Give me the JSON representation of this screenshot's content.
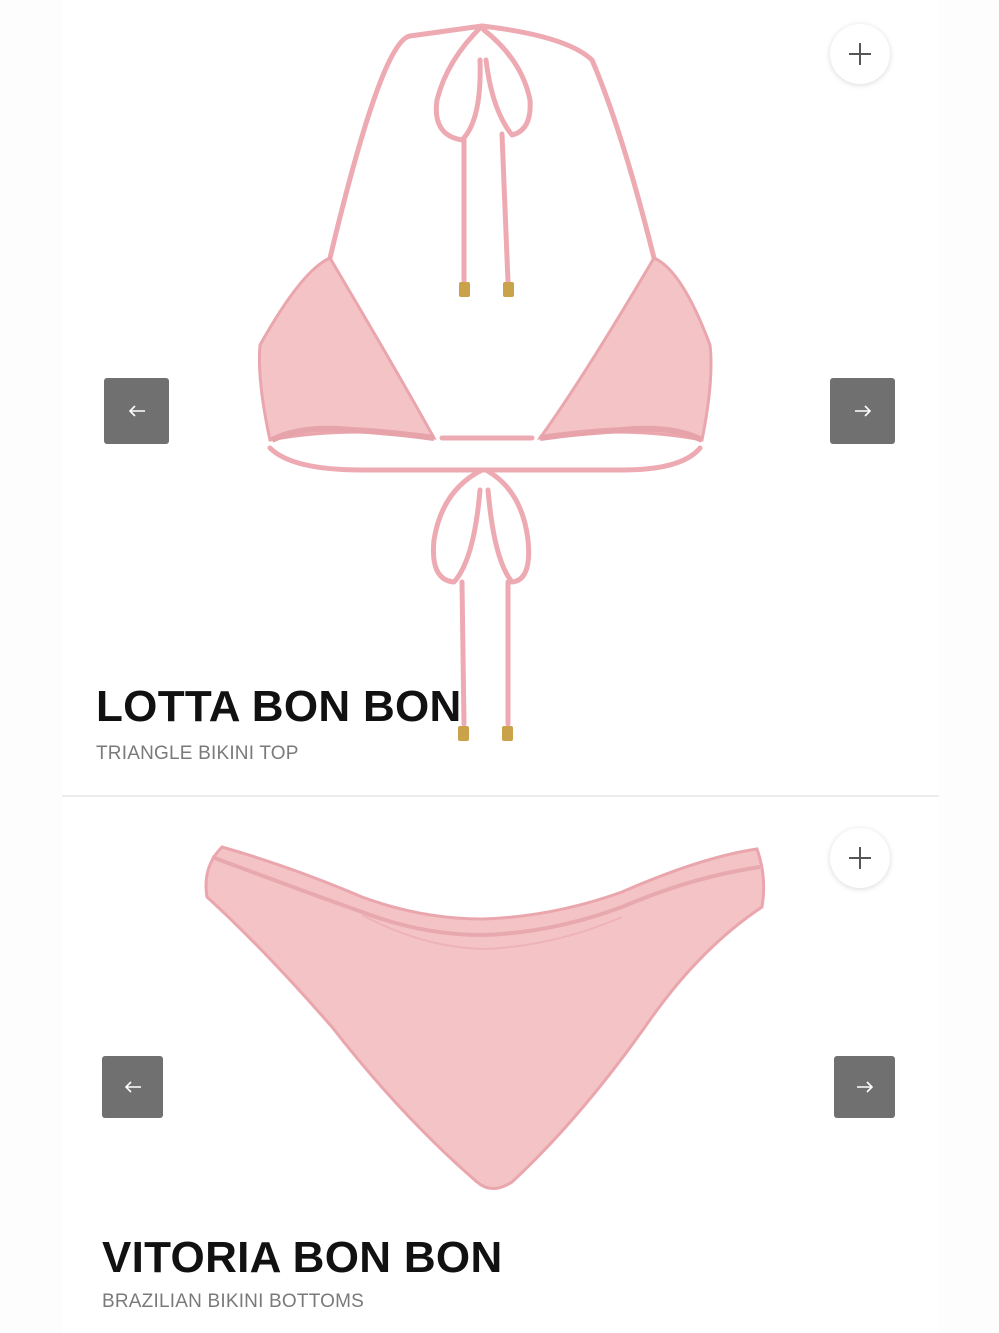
{
  "products": [
    {
      "title": "LOTTA BON BON",
      "subtitle": "TRIANGLE BIKINI TOP",
      "add_icon": "plus-icon",
      "prev_icon": "arrow-left-icon",
      "next_icon": "arrow-right-icon",
      "image": "pink-triangle-bikini-top"
    },
    {
      "title": "VITORIA BON BON",
      "subtitle": "BRAZILIAN BIKINI BOTTOMS",
      "add_icon": "plus-icon",
      "prev_icon": "arrow-left-icon",
      "next_icon": "arrow-right-icon",
      "image": "pink-brazilian-bikini-bottoms"
    }
  ],
  "colors": {
    "product_pink": "#f2bcc0",
    "product_pink_dark": "#e6a3a9",
    "hardware_gold": "#c9a24a",
    "nav_button": "#707070",
    "title": "#111111",
    "subtitle": "#7a7a7a"
  }
}
